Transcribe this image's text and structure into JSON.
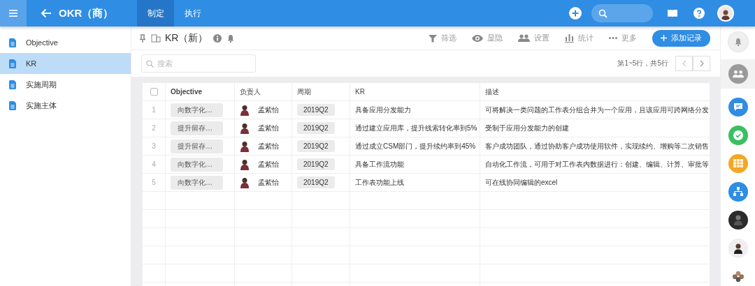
{
  "header": {
    "title": "OKR（商）",
    "tabs": [
      {
        "label": "制定",
        "selected": true
      },
      {
        "label": "执行",
        "selected": false
      }
    ]
  },
  "sidebar": {
    "items": [
      {
        "label": "Objective",
        "selected": false
      },
      {
        "label": "KR",
        "selected": true
      },
      {
        "label": "实施周期",
        "selected": false
      },
      {
        "label": "实施主体",
        "selected": false
      }
    ]
  },
  "toolbar": {
    "title": "KR（新）",
    "actions": [
      {
        "kind": "filter",
        "label": "筛选"
      },
      {
        "kind": "visibility",
        "label": "显隐"
      },
      {
        "kind": "people",
        "label": "设置"
      },
      {
        "kind": "stats",
        "label": "统计"
      },
      {
        "kind": "more",
        "label": "更多"
      }
    ],
    "add_button": "添加记录"
  },
  "search": {
    "placeholder": "搜索"
  },
  "pager": {
    "text": "第1~5行，共5行"
  },
  "table": {
    "select_all": {
      "checked": false
    },
    "columns": [
      "Objective",
      "负责人",
      "周期",
      "KR",
      "描述"
    ],
    "rows": [
      {
        "index": "1",
        "objective": "向数字化…",
        "owner": "孟紫怡",
        "period": "2019Q2",
        "kr": "具备应用分发能力",
        "description": "可将解决一类问题的工作表分组合并为一个应用，且该应用可跨网络分发"
      },
      {
        "index": "2",
        "objective": "提升留存…",
        "owner": "孟紫怡",
        "period": "2019Q2",
        "kr": "通过建立应用库，提升线索转化率到5%",
        "description": "受制于应用分发能力的创建"
      },
      {
        "index": "3",
        "objective": "提升留存…",
        "owner": "孟紫怡",
        "period": "2019Q2",
        "kr": "通过成立CSM部门，提升续约率到45%",
        "description": "客户成功团队，通过协助客户成功使用软件，实现续约、增购等二次销售"
      },
      {
        "index": "4",
        "objective": "向数字化…",
        "owner": "孟紫怡",
        "period": "2019Q2",
        "kr": "具备工作流功能",
        "description": "自动化工作流，可用于对工作表内数据进行：创建、编辑、计算、审批等"
      },
      {
        "index": "5",
        "objective": "向数字化…",
        "owner": "孟紫怡",
        "period": "2019Q2",
        "kr": "工作表功能上线",
        "description": "可在线协同编辑的excel"
      }
    ]
  }
}
